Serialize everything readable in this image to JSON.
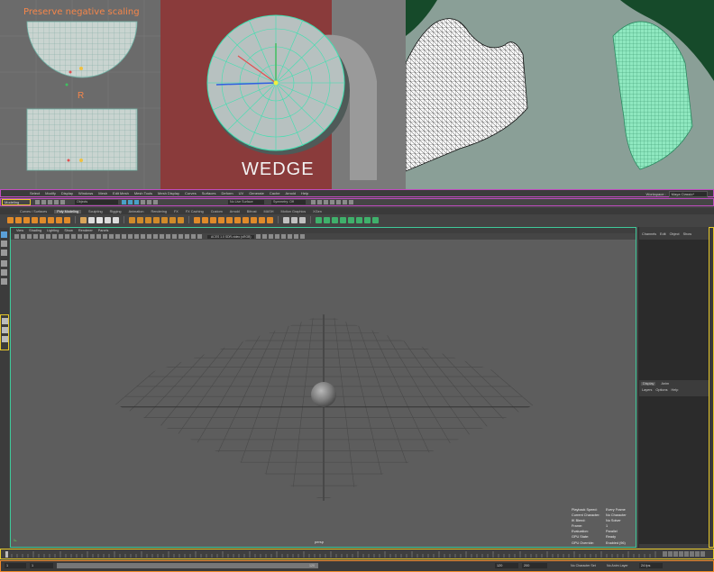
{
  "showcase": {
    "panel_a": {
      "title": "Preserve negative scaling",
      "r_label": "R"
    },
    "panel_b": {
      "label": "WEDGE"
    }
  },
  "menubar": {
    "items": [
      "Select",
      "Modify",
      "Display",
      "Windows",
      "Mesh",
      "Edit Mesh",
      "Mesh Tools",
      "Mesh Display",
      "Curves",
      "Surfaces",
      "Deform",
      "UV",
      "Generate",
      "Cache",
      "Arnold",
      "Help"
    ],
    "workspace_label": "Workspace :",
    "workspace_value": "Maya Classic*"
  },
  "statusline": {
    "mode": "Modeling",
    "objects_field": "Objects",
    "live_surface": "No Live Surface",
    "symmetry": "Symmetry: Off"
  },
  "shelf": {
    "tabs": [
      "Curves / Surfaces",
      "Poly Modeling",
      "Sculpting",
      "Rigging",
      "Animation",
      "Rendering",
      "FX",
      "FX Caching",
      "Custom",
      "Arnold",
      "Bifrost",
      "MASH",
      "Motion Graphics",
      "XGen"
    ],
    "active_tab": "Poly Modeling",
    "icon_colors": [
      "#e08a2a",
      "#e08a2a",
      "#e08a2a",
      "#e08a2a",
      "#e08a2a",
      "#e08a2a",
      "#e08a2a",
      "#e08a2a",
      "#d9a55a",
      "#dcdcdc",
      "#e6e6e6",
      "#dcdcdc",
      "#dcdcdc",
      "#d08a2a",
      "#d08a2a",
      "#d08a2a",
      "#d08a2a",
      "#d08a2a",
      "#d08a2a",
      "#d08a2a",
      "#e08a2a",
      "#e08a2a",
      "#e08a2a",
      "#e08a2a",
      "#e08a2a",
      "#e08a2a",
      "#e08a2a",
      "#e08a2a",
      "#e08a2a",
      "#e08a2a",
      "#c0c0c0",
      "#c0c0c0",
      "#c0c0c0",
      "#3fb06b",
      "#3fb06b",
      "#3fb06b",
      "#3fb06b",
      "#3fb06b",
      "#3fb06b",
      "#3fb06b",
      "#3fb06b"
    ]
  },
  "viewport": {
    "menu": [
      "View",
      "Shading",
      "Lighting",
      "Show",
      "Renderer",
      "Panels"
    ],
    "gamma_field": "ACES 1.0 SDR-video (sRGB)",
    "camera": "persp",
    "hud": [
      {
        "k": "Playback Speed:",
        "v": "Every Frame"
      },
      {
        "k": "Current Character:",
        "v": "No Character"
      },
      {
        "k": "IK Blend:",
        "v": "No Solver"
      },
      {
        "k": "Frame:",
        "v": "1"
      },
      {
        "k": "Evaluation:",
        "v": "Parallel"
      },
      {
        "k": "GPU State:",
        "v": "Ready"
      },
      {
        "k": "GPU Override:",
        "v": "Enabled (96)"
      }
    ]
  },
  "channelbox": {
    "tabs": [
      "Channels",
      "Edit",
      "Object",
      "Show"
    ],
    "layer_tabs": [
      "Display",
      "Anim"
    ],
    "layer_menu": [
      "Layers",
      "Options",
      "Help"
    ]
  },
  "range": {
    "start": "1",
    "inner_start": "1",
    "inner_end": "120",
    "end_a": "120",
    "end_b": "200",
    "character_set": "No Character Set",
    "anim_layer": "No Anim Layer",
    "fps": "24 fps"
  },
  "colors": {
    "accent_teal": "#3fc99a",
    "highlight_yellow": "#e6c82a",
    "highlight_magenta": "#c04cc0",
    "highlight_orange": "#f08a2a"
  }
}
